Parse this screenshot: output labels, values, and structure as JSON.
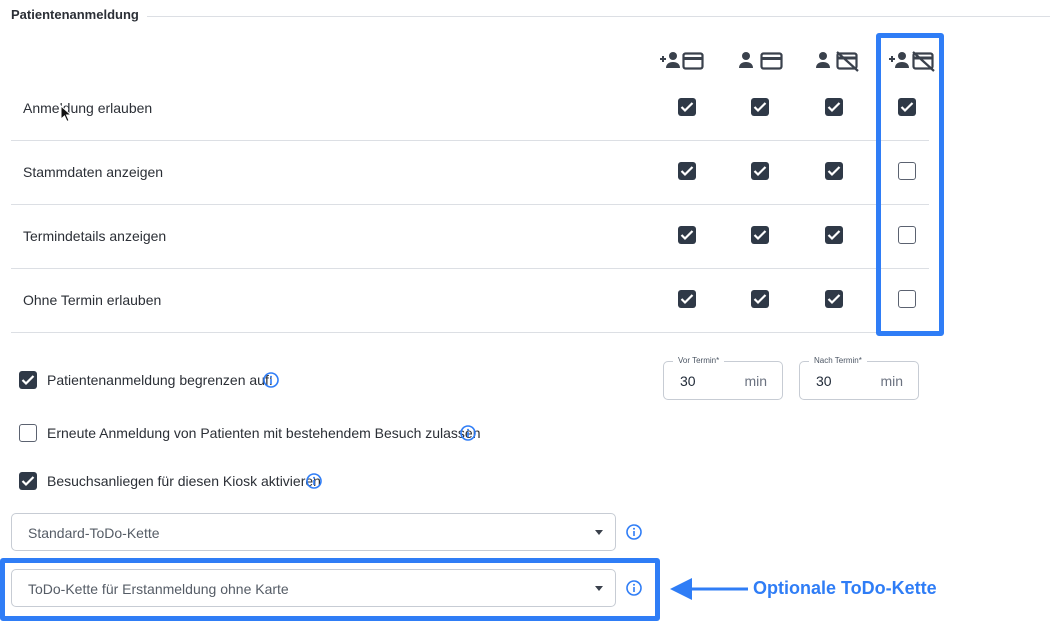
{
  "section": {
    "title": "Patientenanmeldung"
  },
  "columns": [
    {
      "icon": "person-add-card-icon"
    },
    {
      "icon": "person-card-icon"
    },
    {
      "icon": "person-no-card-icon"
    },
    {
      "icon": "person-add-no-card-icon"
    }
  ],
  "rows": [
    {
      "label": "Anmeldung erlauben",
      "checks": [
        true,
        true,
        true,
        true
      ]
    },
    {
      "label": "Stammdaten anzeigen",
      "checks": [
        true,
        true,
        true,
        false
      ]
    },
    {
      "label": "Termindetails anzeigen",
      "checks": [
        true,
        true,
        true,
        false
      ]
    },
    {
      "label": "Ohne Termin erlauben",
      "checks": [
        true,
        true,
        true,
        false
      ]
    }
  ],
  "options": {
    "limit": {
      "label": "Patientenanmeldung begrenzen auf:",
      "checked": true
    },
    "reregister": {
      "label": "Erneute Anmeldung von Patienten mit bestehendem Besuch zulassen",
      "checked": false
    },
    "visit_reasons": {
      "label": "Besuchsanliegen für diesen Kiosk aktivieren",
      "checked": true
    }
  },
  "fields": {
    "before": {
      "legend": "Vor Termin*",
      "value": "30",
      "unit": "min"
    },
    "after": {
      "legend": "Nach Termin*",
      "value": "30",
      "unit": "min"
    }
  },
  "selects": {
    "standard": {
      "placeholder": "Standard-ToDo-Kette"
    },
    "first_no_card": {
      "placeholder": "ToDo-Kette für Erstanmeldung ohne Karte"
    }
  },
  "annotation": {
    "text": "Optionale ToDo-Kette"
  },
  "colors": {
    "accent": "#2f7df6",
    "checkbox": "#2f3947"
  }
}
